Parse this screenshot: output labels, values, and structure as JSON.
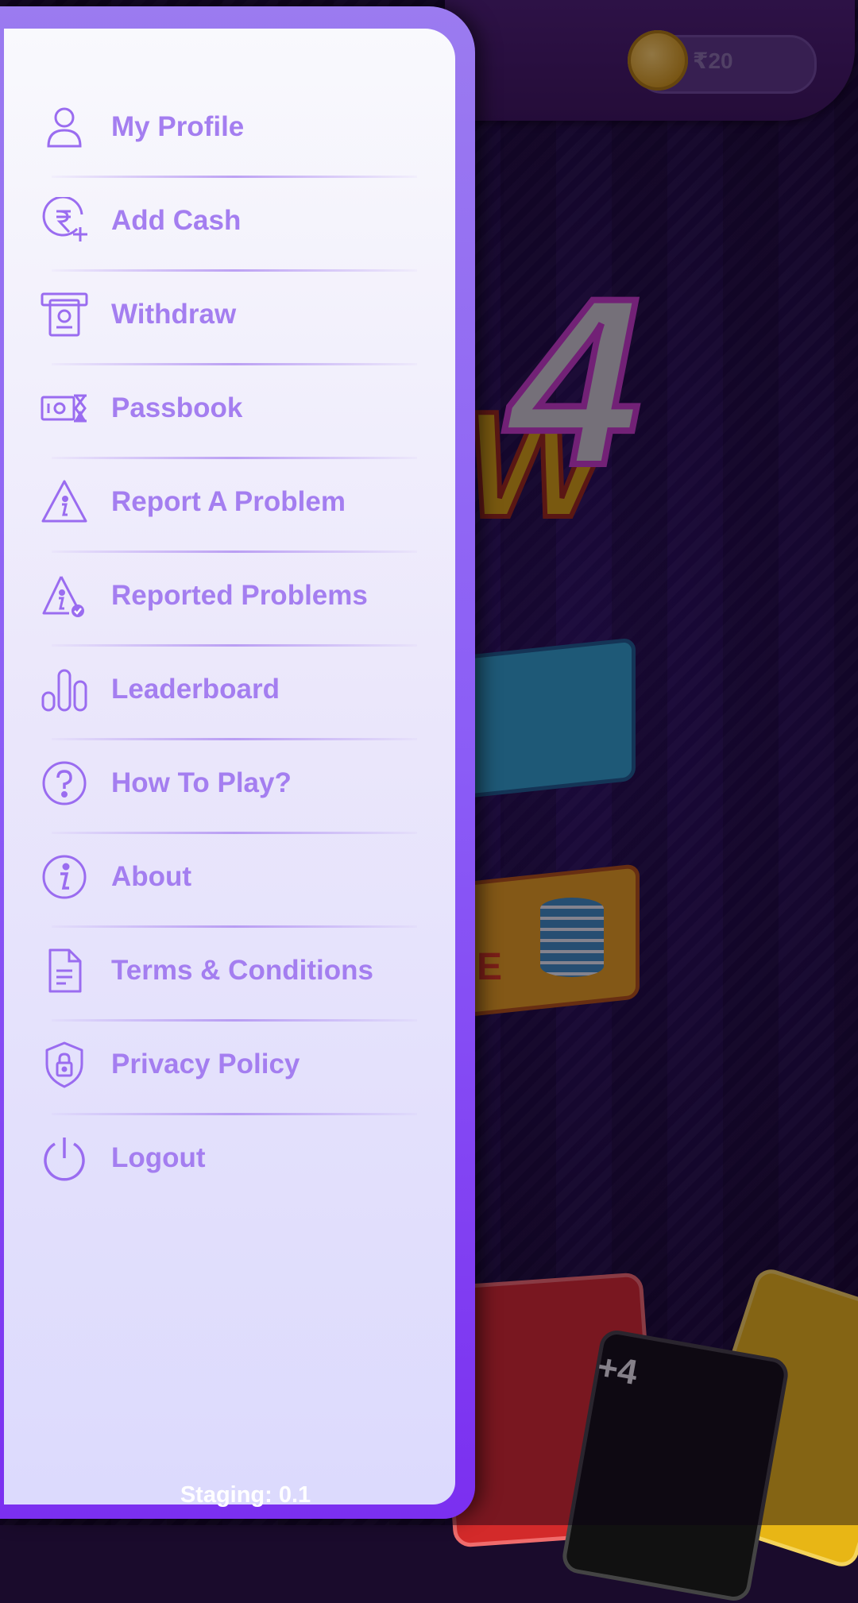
{
  "wallet": {
    "amount": "₹20"
  },
  "background": {
    "plus_card": "+4",
    "logo_digit": "4",
    "logo_letter": "W",
    "free_text": "E"
  },
  "menu": [
    {
      "label": "My Profile",
      "icon": "user-icon"
    },
    {
      "label": "Add Cash",
      "icon": "rupee-add-icon"
    },
    {
      "label": "Withdraw",
      "icon": "atm-withdraw-icon"
    },
    {
      "label": "Passbook",
      "icon": "cash-hourglass-icon"
    },
    {
      "label": "Report A Problem",
      "icon": "warning-info-icon"
    },
    {
      "label": "Reported Problems",
      "icon": "warning-check-icon"
    },
    {
      "label": "Leaderboard",
      "icon": "bar-chart-icon"
    },
    {
      "label": "How To Play?",
      "icon": "question-circle-icon"
    },
    {
      "label": "About",
      "icon": "info-circle-icon"
    },
    {
      "label": "Terms & Conditions",
      "icon": "document-icon"
    },
    {
      "label": "Privacy Policy",
      "icon": "shield-lock-icon"
    },
    {
      "label": "Logout",
      "icon": "power-icon"
    }
  ],
  "footer": {
    "version": "Staging: 0.1"
  },
  "colors": {
    "accent": "#a47ef0",
    "drawer_border": "#8b5cf6",
    "icon_stroke": "#9a6cf0"
  }
}
